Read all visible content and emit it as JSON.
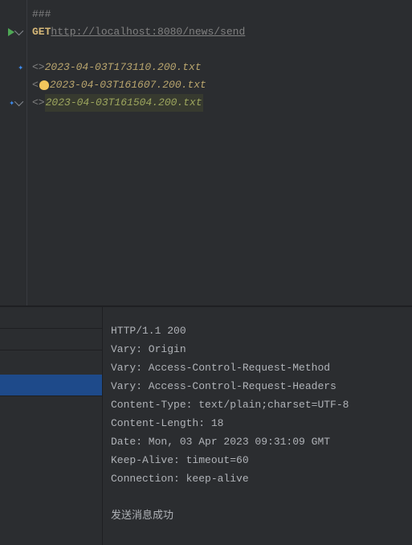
{
  "request": {
    "separator": "###",
    "method": "GET",
    "url": "http://localhost:8080/news/send"
  },
  "history": [
    {
      "marker": "<>",
      "name": "2023-04-03T173110.200.txt",
      "bulb": false,
      "sel": false
    },
    {
      "marker": "<",
      "name": "2023-04-03T161607.200.txt",
      "bulb": true,
      "sel": false
    },
    {
      "marker": "<>",
      "name": "2023-04-03T161504.200.txt",
      "bulb": false,
      "sel": true
    }
  ],
  "response": {
    "lines": [
      "HTTP/1.1 200",
      "Vary: Origin",
      "Vary: Access-Control-Request-Method",
      "Vary: Access-Control-Request-Headers",
      "Content-Type: text/plain;charset=UTF-8",
      "Content-Length: 18",
      "Date: Mon, 03 Apr 2023 09:31:09 GMT",
      "Keep-Alive: timeout=60",
      "Connection: keep-alive",
      "",
      "发送消息成功"
    ]
  }
}
